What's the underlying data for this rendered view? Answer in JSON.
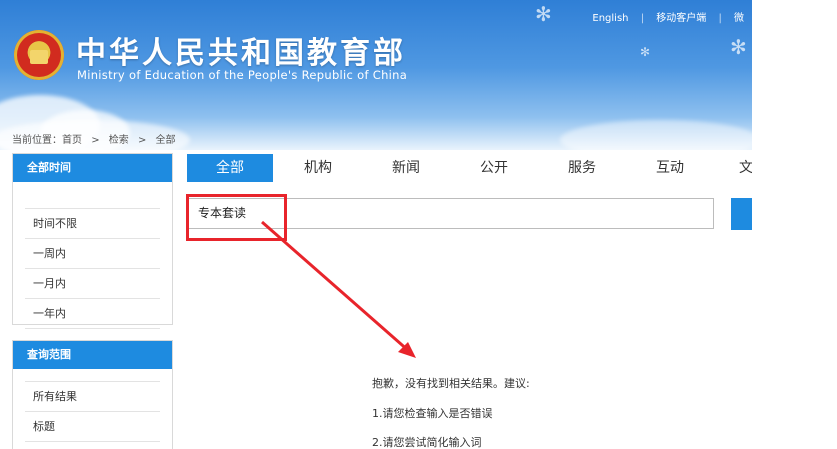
{
  "header": {
    "title_zh": "中华人民共和国教育部",
    "title_en": "Ministry of Education of the People's Republic of China",
    "top_links": [
      "English",
      "移动客户端",
      "微"
    ]
  },
  "breadcrumb": {
    "label": "当前位置：",
    "items": [
      "首页",
      "检索",
      "全部"
    ],
    "separator": ">"
  },
  "sidebar": {
    "time_panel": {
      "title": "全部时间",
      "items": [
        "时间不限",
        "一周内",
        "一月内",
        "一年内"
      ]
    },
    "scope_panel": {
      "title": "查询范围",
      "items": [
        "所有结果",
        "标题"
      ]
    }
  },
  "tabs": [
    {
      "label": "全部",
      "active": true
    },
    {
      "label": "机构",
      "active": false
    },
    {
      "label": "新闻",
      "active": false
    },
    {
      "label": "公开",
      "active": false
    },
    {
      "label": "服务",
      "active": false
    },
    {
      "label": "互动",
      "active": false
    },
    {
      "label": "文",
      "active": false
    }
  ],
  "search": {
    "value": "专本套读"
  },
  "results": {
    "no_result": "抱歉，没有找到相关结果。建议:",
    "suggestions": [
      "1.请您检查输入是否错误",
      "2.请您尝试简化输入词"
    ]
  },
  "colors": {
    "accent": "#1e8be0",
    "annotation": "#e8242b"
  }
}
